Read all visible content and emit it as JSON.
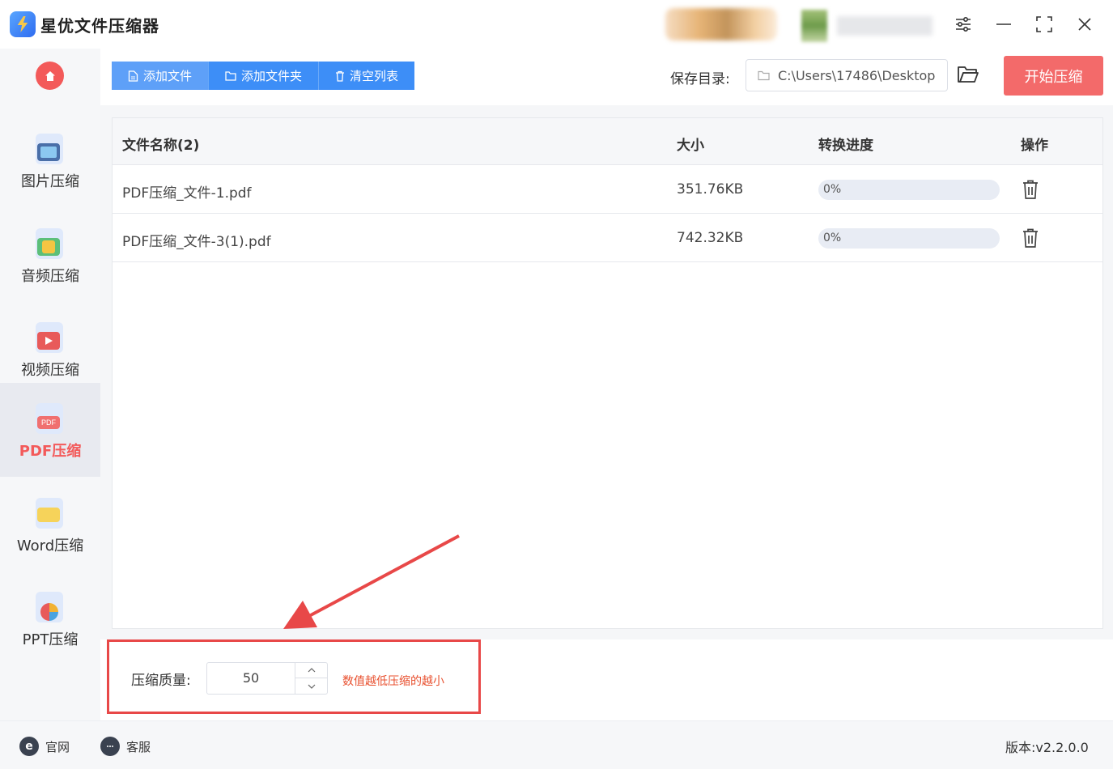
{
  "app": {
    "title": "星优文件压缩器"
  },
  "colors": {
    "accent": "#3d8ef7",
    "danger": "#f36a6a",
    "hint": "#e8502f"
  },
  "sidebar": {
    "items": [
      {
        "label": "图片压缩",
        "icon": "image-icon",
        "active": false
      },
      {
        "label": "音频压缩",
        "icon": "music-icon",
        "active": false
      },
      {
        "label": "视频压缩",
        "icon": "video-icon",
        "active": false
      },
      {
        "label": "PDF压缩",
        "icon": "pdf-icon",
        "active": true
      },
      {
        "label": "Word压缩",
        "icon": "word-icon",
        "active": false
      },
      {
        "label": "PPT压缩",
        "icon": "ppt-icon",
        "active": false
      }
    ],
    "pdf_badge": "PDF"
  },
  "toolbar": {
    "add_file": "添加文件",
    "add_folder": "添加文件夹",
    "clear_list": "清空列表",
    "save_label": "保存目录:",
    "save_path": "C:\\Users\\17486\\Desktop",
    "start": "开始压缩"
  },
  "table": {
    "headers": {
      "name": "文件名称(2)",
      "size": "大小",
      "progress": "转换进度",
      "action": "操作"
    },
    "rows": [
      {
        "name": "PDF压缩_文件-1.pdf",
        "size": "351.76KB",
        "progress": "0%",
        "progress_value": 0
      },
      {
        "name": "PDF压缩_文件-3(1).pdf",
        "size": "742.32KB",
        "progress": "0%",
        "progress_value": 0
      }
    ]
  },
  "settings": {
    "quality_label": "压缩质量:",
    "quality_value": "50",
    "hint": "数值越低压缩的越小"
  },
  "statusbar": {
    "website": "官网",
    "service": "客服",
    "version": "版本:v2.2.0.0"
  }
}
